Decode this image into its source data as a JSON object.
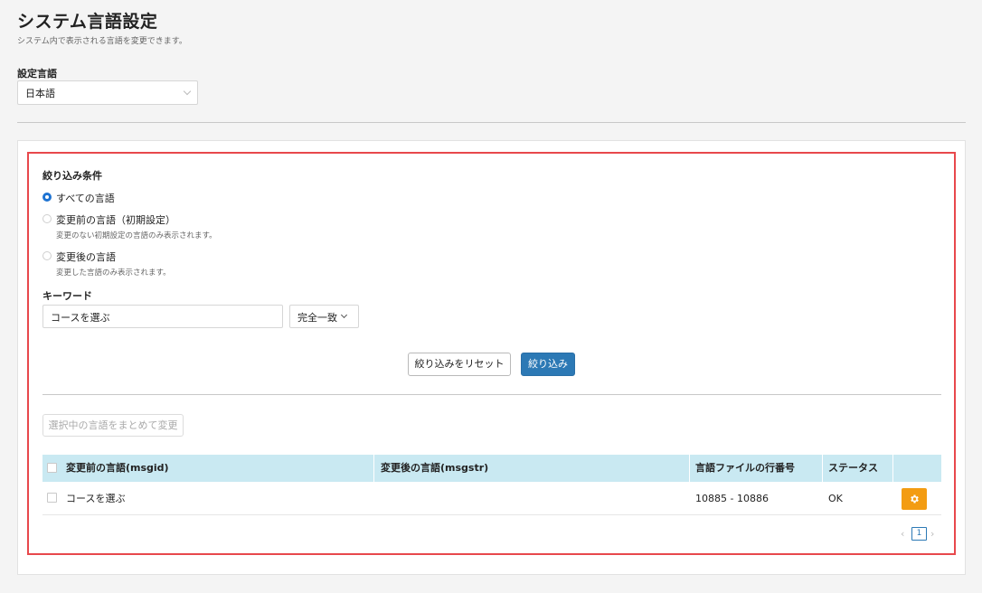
{
  "page": {
    "title": "システム言語設定",
    "subtitle": "システム内で表示される言語を変更できます。"
  },
  "language": {
    "label": "設定言語",
    "selected": "日本語"
  },
  "filter": {
    "title": "絞り込み条件",
    "options": [
      {
        "label": "すべての言語",
        "description": "",
        "checked": true
      },
      {
        "label": "変更前の言語（初期設定）",
        "description": "変更のない初期設定の言語のみ表示されます。",
        "checked": false
      },
      {
        "label": "変更後の言語",
        "description": "変更した言語のみ表示されます。",
        "checked": false
      }
    ],
    "keyword_label": "キーワード",
    "keyword_value": "コースを選ぶ",
    "match_mode": "完全一致",
    "reset_label": "絞り込みをリセット",
    "apply_label": "絞り込み"
  },
  "bulk_change_label": "選択中の言語をまとめて変更",
  "table": {
    "headers": [
      "変更前の言語(msgid)",
      "変更後の言語(msgstr)",
      "言語ファイルの行番号",
      "ステータス"
    ],
    "rows": [
      {
        "msgid": "コースを選ぶ",
        "msgstr": "",
        "line": "10885 - 10886",
        "status": "OK"
      }
    ]
  },
  "pagination": {
    "prev": "‹",
    "current": "1",
    "next": "›"
  },
  "colors": {
    "accent": "#2c79b5",
    "highlight_border": "#e8484c",
    "table_header": "#c9e9f2",
    "action_button": "#f39c12"
  },
  "icons": [
    "chevron-down-icon",
    "gear-icon"
  ]
}
